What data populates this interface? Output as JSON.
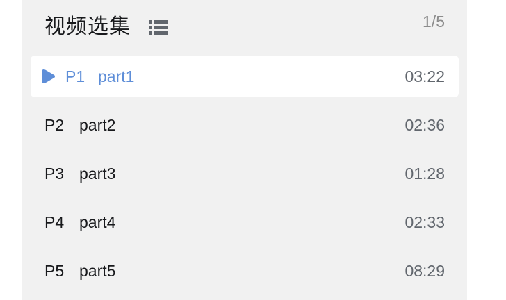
{
  "header": {
    "title": "视频选集",
    "list_icon": "list-icon",
    "count": "1/5"
  },
  "episodes": [
    {
      "num": "P1",
      "title": "part1",
      "duration": "03:22",
      "active": true,
      "icon": "play-icon"
    },
    {
      "num": "P2",
      "title": "part2",
      "duration": "02:36",
      "active": false
    },
    {
      "num": "P3",
      "title": "part3",
      "duration": "01:28",
      "active": false
    },
    {
      "num": "P4",
      "title": "part4",
      "duration": "02:33",
      "active": false
    },
    {
      "num": "P5",
      "title": "part5",
      "duration": "08:29",
      "active": false
    }
  ],
  "colors": {
    "accent": "#5e8ed8",
    "panel_bg": "#f1f1f1",
    "active_row_bg": "#ffffff",
    "text": "#18191c",
    "muted": "#8c8c8c"
  }
}
